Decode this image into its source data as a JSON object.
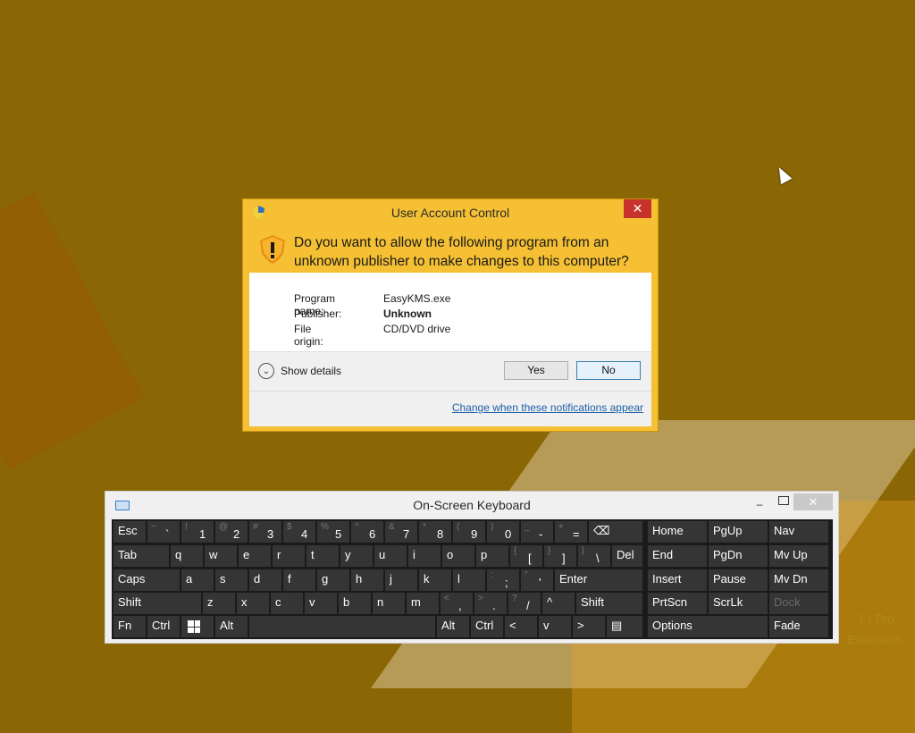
{
  "desktop": {
    "corner_text_1": "1 | Pro",
    "corner_text_2": "Evaluation"
  },
  "uac": {
    "title": "User Account Control",
    "close_glyph": "✕",
    "question": "Do you want to allow the following program from an unknown publisher to make changes to this computer?",
    "info": [
      {
        "key": "Program name:",
        "value": "EasyKMS.exe",
        "bold": false
      },
      {
        "key": "Publisher:",
        "value": "Unknown",
        "bold": true
      },
      {
        "key": "File origin:",
        "value": "CD/DVD drive",
        "bold": false
      }
    ],
    "show_details": "Show details",
    "yes": "Yes",
    "no": "No",
    "link": "Change when these notifications appear",
    "accent": "#f5c033"
  },
  "osk": {
    "title": "On-Screen Keyboard",
    "minimize_glyph": "–",
    "close_glyph": "✕",
    "rows": {
      "r1": [
        {
          "name": "key-esc",
          "label": "Esc"
        },
        {
          "name": "key-backtick",
          "sub": "~",
          "main": "`"
        },
        {
          "name": "key-1",
          "sub": "!",
          "main": "1"
        },
        {
          "name": "key-2",
          "sub": "@",
          "main": "2"
        },
        {
          "name": "key-3",
          "sub": "#",
          "main": "3"
        },
        {
          "name": "key-4",
          "sub": "$",
          "main": "4"
        },
        {
          "name": "key-5",
          "sub": "%",
          "main": "5"
        },
        {
          "name": "key-6",
          "sub": "^",
          "main": "6"
        },
        {
          "name": "key-7",
          "sub": "&",
          "main": "7"
        },
        {
          "name": "key-8",
          "sub": "*",
          "main": "8"
        },
        {
          "name": "key-9",
          "sub": "(",
          "main": "9"
        },
        {
          "name": "key-0",
          "sub": ")",
          "main": "0"
        },
        {
          "name": "key-minus",
          "sub": "_",
          "main": "-"
        },
        {
          "name": "key-equals",
          "sub": "+",
          "main": "="
        },
        {
          "name": "key-backspace",
          "label": "⌫"
        }
      ],
      "r2": [
        {
          "name": "key-tab",
          "label": "Tab"
        },
        {
          "name": "key-q",
          "label": "q"
        },
        {
          "name": "key-w",
          "label": "w"
        },
        {
          "name": "key-e",
          "label": "e"
        },
        {
          "name": "key-r",
          "label": "r"
        },
        {
          "name": "key-t",
          "label": "t"
        },
        {
          "name": "key-y",
          "label": "y"
        },
        {
          "name": "key-u",
          "label": "u"
        },
        {
          "name": "key-i",
          "label": "i"
        },
        {
          "name": "key-o",
          "label": "o"
        },
        {
          "name": "key-p",
          "label": "p"
        },
        {
          "name": "key-lbracket",
          "sub": "{",
          "main": "["
        },
        {
          "name": "key-rbracket",
          "sub": "}",
          "main": "]"
        },
        {
          "name": "key-backslash",
          "sub": "|",
          "main": "\\"
        },
        {
          "name": "key-del",
          "label": "Del"
        }
      ],
      "r3": [
        {
          "name": "key-caps",
          "label": "Caps"
        },
        {
          "name": "key-a",
          "label": "a"
        },
        {
          "name": "key-s",
          "label": "s"
        },
        {
          "name": "key-d",
          "label": "d"
        },
        {
          "name": "key-f",
          "label": "f"
        },
        {
          "name": "key-g",
          "label": "g"
        },
        {
          "name": "key-h",
          "label": "h"
        },
        {
          "name": "key-j",
          "label": "j"
        },
        {
          "name": "key-k",
          "label": "k"
        },
        {
          "name": "key-l",
          "label": "l"
        },
        {
          "name": "key-semicolon",
          "sub": ":",
          "main": ";"
        },
        {
          "name": "key-quote",
          "sub": "\"",
          "main": "'"
        },
        {
          "name": "key-enter",
          "label": "Enter"
        }
      ],
      "r4": [
        {
          "name": "key-shift-left",
          "label": "Shift"
        },
        {
          "name": "key-z",
          "label": "z"
        },
        {
          "name": "key-x",
          "label": "x"
        },
        {
          "name": "key-c",
          "label": "c"
        },
        {
          "name": "key-v",
          "label": "v"
        },
        {
          "name": "key-b",
          "label": "b"
        },
        {
          "name": "key-n",
          "label": "n"
        },
        {
          "name": "key-m",
          "label": "m"
        },
        {
          "name": "key-comma",
          "sub": "<",
          "main": ","
        },
        {
          "name": "key-period",
          "sub": ">",
          "main": "."
        },
        {
          "name": "key-slash",
          "sub": "?",
          "main": "/"
        },
        {
          "name": "key-up",
          "label": "^"
        },
        {
          "name": "key-shift-right",
          "label": "Shift"
        }
      ],
      "r5": [
        {
          "name": "key-fn",
          "label": "Fn"
        },
        {
          "name": "key-ctrl-left",
          "label": "Ctrl"
        },
        {
          "name": "key-win",
          "label": ""
        },
        {
          "name": "key-alt-left",
          "label": "Alt"
        },
        {
          "name": "key-space",
          "label": ""
        },
        {
          "name": "key-alt-right",
          "label": "Alt"
        },
        {
          "name": "key-ctrl-right",
          "label": "Ctrl"
        },
        {
          "name": "key-left",
          "label": "<"
        },
        {
          "name": "key-down",
          "label": "v"
        },
        {
          "name": "key-right",
          "label": ">"
        },
        {
          "name": "key-menu",
          "label": "▤"
        }
      ],
      "nav": [
        {
          "name": "key-home",
          "label": "Home"
        },
        {
          "name": "key-pgup",
          "label": "PgUp"
        },
        {
          "name": "key-nav",
          "label": "Nav"
        },
        {
          "name": "key-end",
          "label": "End"
        },
        {
          "name": "key-pgdn",
          "label": "PgDn"
        },
        {
          "name": "key-mvup",
          "label": "Mv Up"
        },
        {
          "name": "key-insert",
          "label": "Insert"
        },
        {
          "name": "key-pause",
          "label": "Pause"
        },
        {
          "name": "key-mvdn",
          "label": "Mv Dn"
        },
        {
          "name": "key-prtscn",
          "label": "PrtScn"
        },
        {
          "name": "key-scrlk",
          "label": "ScrLk"
        },
        {
          "name": "key-dock",
          "label": "Dock"
        },
        {
          "name": "key-options",
          "label": "Options"
        },
        {
          "name": "key-fade",
          "label": "Fade"
        }
      ]
    }
  }
}
